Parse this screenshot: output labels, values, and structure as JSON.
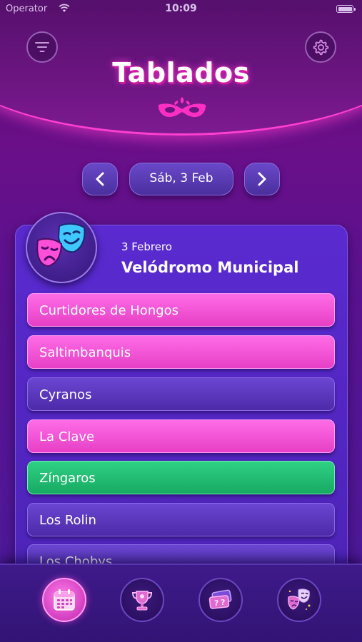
{
  "status_bar": {
    "carrier": "Operator",
    "time": "10:09"
  },
  "header": {
    "title": "Tablados",
    "filter_icon": "filter-icon",
    "settings_icon": "gear-icon",
    "emblem_icon": "carnival-mask-icon"
  },
  "date_nav": {
    "prev_icon": "chevron-left-icon",
    "current": "Sáb, 3 Feb",
    "next_icon": "chevron-right-icon"
  },
  "venue": {
    "date": "3 Febrero",
    "name": "Velódromo Municipal",
    "avatar_icon": "theater-masks-icon",
    "groups": [
      {
        "name": "Curtidores de Hongos",
        "color": "#f055d8"
      },
      {
        "name": "Saltimbanquis",
        "color": "#f055d8"
      },
      {
        "name": "Cyranos",
        "color": "#5a36bd"
      },
      {
        "name": "La Clave",
        "color": "#f055d8"
      },
      {
        "name": "Zíngaros",
        "color": "#22bf72"
      },
      {
        "name": "Los Rolin",
        "color": "#5a36bd"
      },
      {
        "name": "Los Chobys",
        "color": "#5a36bd"
      }
    ]
  },
  "tabs": [
    {
      "id": "calendar",
      "icon": "calendar-icon",
      "active": true
    },
    {
      "id": "trophy",
      "icon": "trophy-icon",
      "active": false
    },
    {
      "id": "tickets",
      "icon": "tickets-icon",
      "active": false
    },
    {
      "id": "masks",
      "icon": "theater-masks-icon",
      "active": false
    }
  ],
  "colors": {
    "accent_pink": "#f055d8",
    "accent_purple": "#5a36bd",
    "accent_green": "#22bf72",
    "background": "#5a1290"
  }
}
